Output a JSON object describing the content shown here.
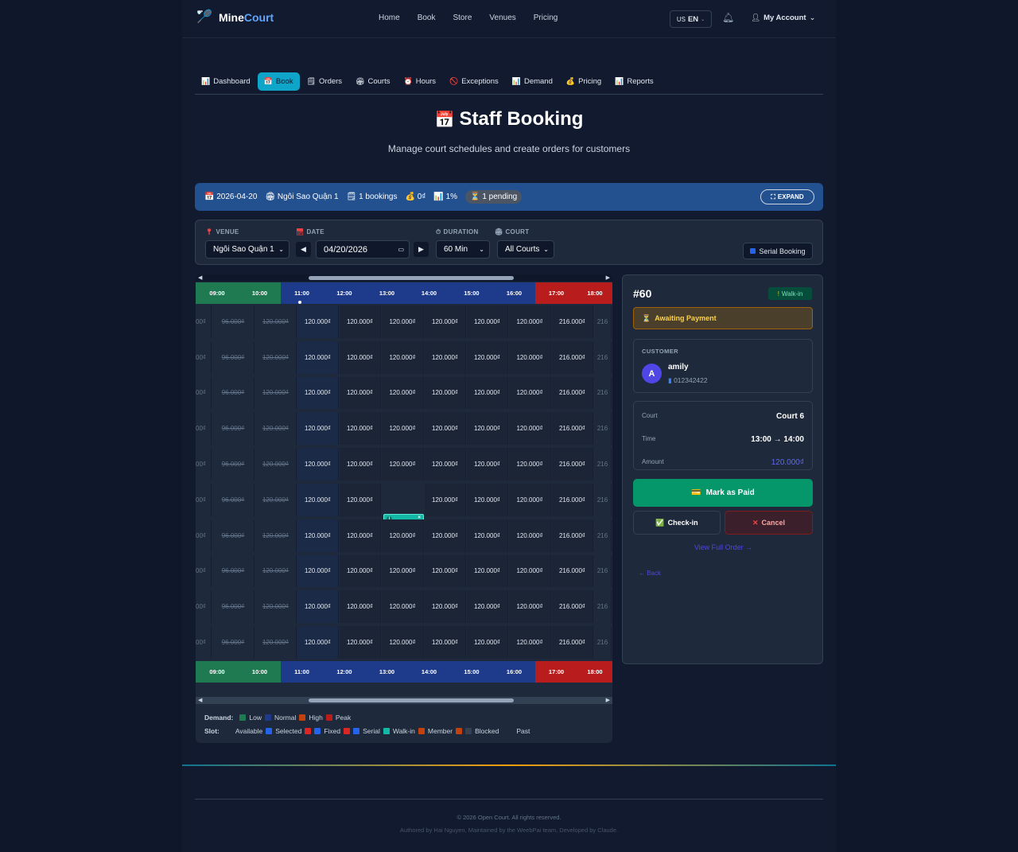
{
  "app": {
    "name_prefix": "Mine",
    "name_suffix": "Court"
  },
  "nav": [
    "Home",
    "Book",
    "Store",
    "Venues",
    "Pricing"
  ],
  "lang": {
    "flag": "US",
    "code": "EN"
  },
  "account": "My Account",
  "tabs": [
    {
      "icon": "📊",
      "label": "Dashboard"
    },
    {
      "icon": "📅",
      "label": "Book"
    },
    {
      "icon": "🗒",
      "label": "Orders"
    },
    {
      "icon": "🏟",
      "label": "Courts"
    },
    {
      "icon": "⏰",
      "label": "Hours"
    },
    {
      "icon": "🚫",
      "label": "Exceptions"
    },
    {
      "icon": "📊",
      "label": "Demand"
    },
    {
      "icon": "💰",
      "label": "Pricing"
    },
    {
      "icon": "📊",
      "label": "Reports"
    }
  ],
  "page": {
    "title": "Staff Booking",
    "subtitle": "Manage court schedules and create orders for customers"
  },
  "summary": {
    "date": "2026-04-20",
    "venue": "Ngôi Sao Quận 1",
    "bookings": "1 bookings",
    "revenue": "0₫",
    "rate": "1%",
    "pending": "1 pending",
    "expand": "EXPAND"
  },
  "filter": {
    "venue_label": "VENUE",
    "venue": "Ngôi Sao Quận 1",
    "date_label": "DATE",
    "date": "04/20/2026",
    "duration_label": "DURATION",
    "duration": "60 Min",
    "court_label": "COURT",
    "court": "All Courts",
    "serial": "Serial Booking"
  },
  "schedule": {
    "hours": [
      "09:00",
      "10:00",
      "11:00",
      "12:00",
      "13:00",
      "14:00",
      "15:00",
      "16:00",
      "17:00",
      "18:00"
    ],
    "hour_demand": [
      "low",
      "low",
      "normal",
      "normal",
      "normal",
      "normal",
      "normal",
      "normal",
      "peak",
      "peak"
    ],
    "row_prices": [
      "00₫",
      "96.000₫",
      "120.000₫",
      "120.000₫",
      "120.000₫",
      "120.000₫",
      "120.000₫",
      "120.000₫",
      "120.000₫",
      "216.000₫",
      "216"
    ],
    "booked": {
      "name": "amily",
      "id": "#60"
    }
  },
  "legend": {
    "demand_label": "Demand:",
    "demand": [
      "Low",
      "Normal",
      "High",
      "Peak"
    ],
    "slot_label": "Slot:",
    "slot": [
      "Available",
      "Selected",
      "Fixed",
      "Serial",
      "Walk-in",
      "Member",
      "Blocked",
      "Past"
    ]
  },
  "detail": {
    "id": "#60",
    "type": "Walk-in",
    "status": "Awaiting Payment",
    "customer_label": "CUSTOMER",
    "avatar": "A",
    "name": "amily",
    "phone": "012342422",
    "court_label": "Court",
    "court": "Court 6",
    "time_label": "Time",
    "time": "13:00 → 14:00",
    "amount_label": "Amount",
    "amount": "120.000₫",
    "paid": "Mark as Paid",
    "checkin": "Check-in",
    "cancel": "Cancel",
    "view": "View Full Order →",
    "back": "← Back"
  },
  "footer": {
    "copyright": "© 2026 Open Court. All rights reserved.",
    "credits": "Authored by Hai Nguyen, Maintained by the WeebPai team, Developed by Claude."
  },
  "colors": {
    "low": "#1f7a52",
    "normal": "#1e3a8a",
    "peak": "#b91c1c",
    "accent": "#0ea5c9"
  }
}
